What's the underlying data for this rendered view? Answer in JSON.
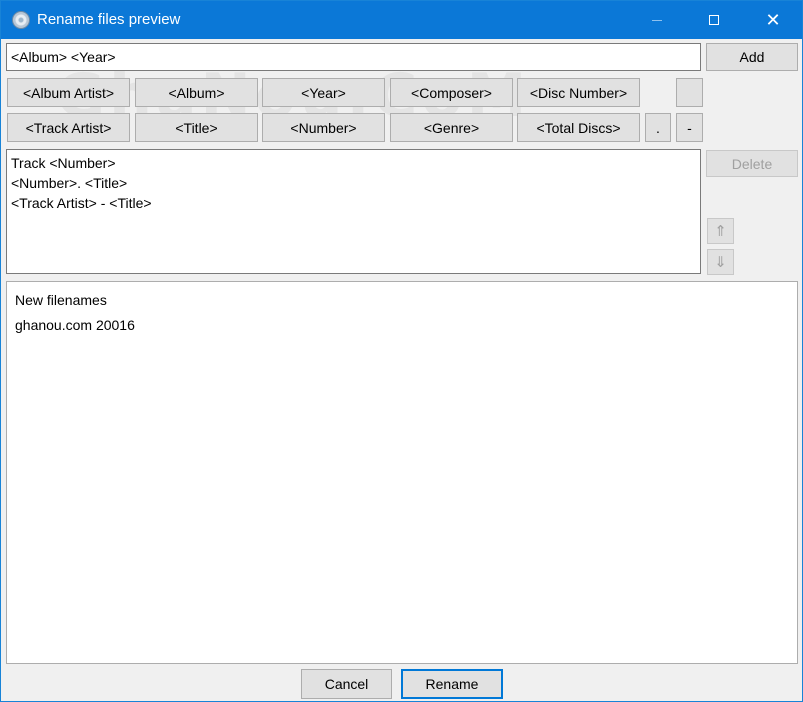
{
  "window": {
    "title": "Rename files preview",
    "controls": {
      "minimize": "minimize",
      "maximize": "maximize",
      "close": "✕"
    }
  },
  "pattern": {
    "value": "<Album> <Year>"
  },
  "add_label": "Add",
  "tag_buttons": {
    "album_artist": "<Album Artist>",
    "album": "<Album>",
    "year": "<Year>",
    "composer": "<Composer>",
    "disc_number": "<Disc Number>",
    "blank": "",
    "track_artist": "<Track Artist>",
    "title": "<Title>",
    "number": "<Number>",
    "genre": "<Genre>",
    "total_discs": "<Total Discs>",
    "dot": ".",
    "dash": "-"
  },
  "templates": [
    "Track <Number>",
    "<Number>. <Title>",
    "<Track Artist> - <Title>"
  ],
  "delete_label": "Delete",
  "move_up": "⇑",
  "move_down": "⇓",
  "new_filenames": {
    "header": "New filenames",
    "items": [
      "ghanou.com 20016"
    ]
  },
  "footer": {
    "cancel": "Cancel",
    "rename": "Rename"
  },
  "watermark": "GhaNou.CoM",
  "colors": {
    "titlebar": "#0b78d7",
    "primary_border": "#0078d7"
  }
}
